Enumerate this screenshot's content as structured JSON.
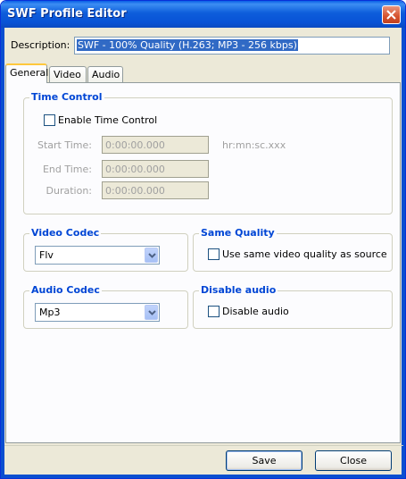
{
  "window": {
    "title": "SWF Profile Editor"
  },
  "description": {
    "label": "Description:",
    "value": "SWF - 100% Quality (H.263; MP3 - 256 kbps)"
  },
  "tabs": [
    {
      "label": "General",
      "active": true
    },
    {
      "label": "Video",
      "active": false
    },
    {
      "label": "Audio",
      "active": false
    }
  ],
  "time_control": {
    "title": "Time Control",
    "enable_label": "Enable Time Control",
    "enable_checked": false,
    "start_label": "Start Time:",
    "start_value": "0:00:00.000",
    "format_hint": "hr:mn:sc.xxx",
    "end_label": "End Time:",
    "end_value": "0:00:00.000",
    "duration_label": "Duration:",
    "duration_value": "0:00:00.000"
  },
  "video_codec": {
    "title": "Video Codec",
    "selected": "Flv"
  },
  "same_quality": {
    "title": "Same Quality",
    "label": "Use same video quality as source",
    "checked": false
  },
  "audio_codec": {
    "title": "Audio Codec",
    "selected": "Mp3"
  },
  "disable_audio": {
    "title": "Disable audio",
    "label": "Disable audio",
    "checked": false
  },
  "buttons": {
    "save": "Save",
    "close": "Close"
  },
  "icons": {
    "close": "close-icon",
    "dropdown": "chevron-down-icon"
  }
}
